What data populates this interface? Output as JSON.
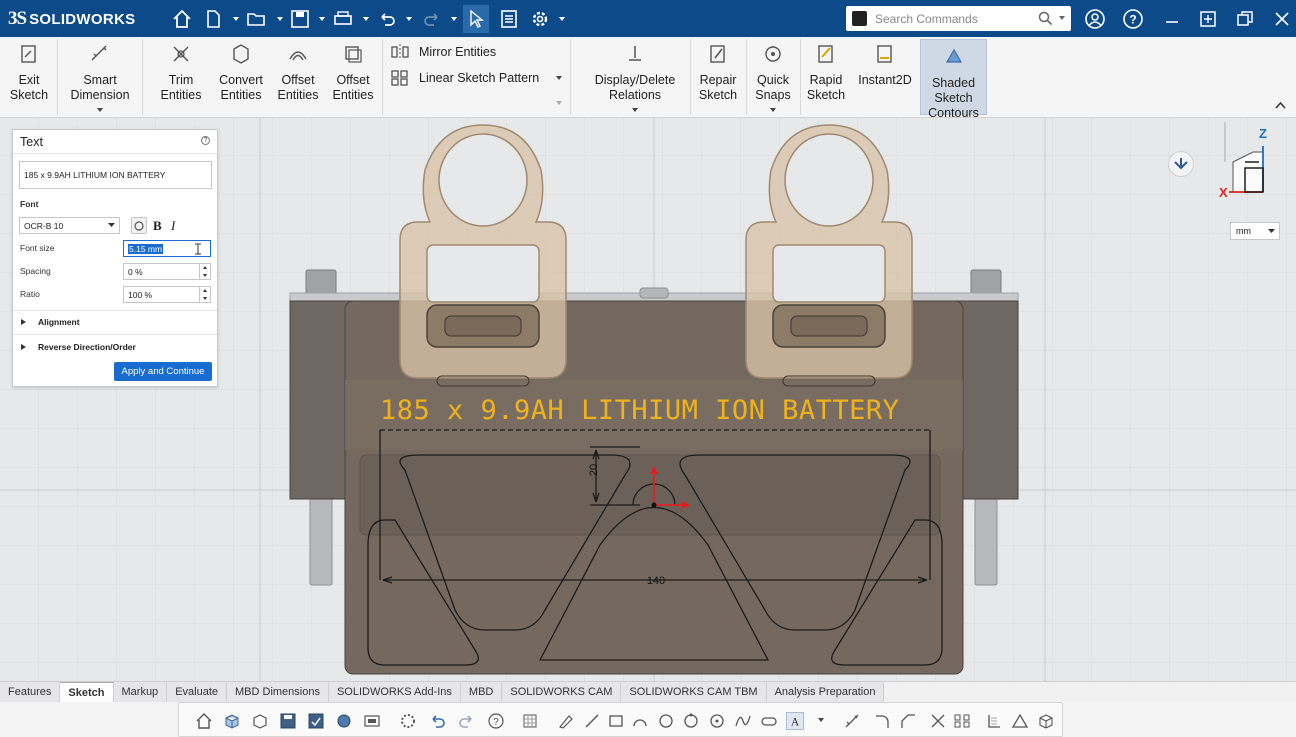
{
  "app": {
    "logo_mark": "3S",
    "logo_name": "SOLIDWORKS",
    "brand_color": "#0c4a8a",
    "search_placeholder": "Search Commands"
  },
  "titlebar_icons": [
    "home-icon",
    "new-document-icon",
    "open-folder-icon",
    "save-icon",
    "print-icon",
    "undo-icon",
    "redo-icon",
    "select-arrow-icon",
    "file-properties-icon",
    "options-gear-icon",
    "user-icon",
    "help-icon",
    "minimize-icon",
    "restore-icon",
    "maximize-icon",
    "close-icon"
  ],
  "ribbon": {
    "exit_sketch": "Exit\nSketch",
    "smart_dimension": "Smart\nDimension",
    "trim_entities": "Trim\nEntities",
    "convert_entities": "Convert\nEntities",
    "offset_entities": "Offset\nEntities",
    "offset_entities_2": "Offset\nEntities",
    "mirror_entities": "Mirror Entities",
    "linear_sketch_pattern": "Linear Sketch Pattern",
    "display_delete_relations": "Display/Delete\nRelations",
    "repair_sketch": "Repair\nSketch",
    "quick_snaps": "Quick\nSnaps",
    "rapid_sketch": "Rapid\nSketch",
    "instant2d": "Instant2D",
    "shaded_sketch_contours": "Shaded\nSketch\nContours"
  },
  "property_manager": {
    "title": "Text",
    "help": "?",
    "text_value": "185 x 9.9AH LITHIUM ION BATTERY",
    "font_heading": "Font",
    "font_value": "OCR-B 10",
    "bold": "B",
    "italic": "I",
    "font_size_label": "Font size",
    "font_size_value": "5.15 mm",
    "spacing_label": "Spacing",
    "spacing_value": "0 %",
    "ratio_label": "Ratio",
    "ratio_value": "100 %",
    "alignment": "Alignment",
    "reverse_direction": "Reverse Direction/Order",
    "apply_button": "Apply and Continue"
  },
  "viewport": {
    "engraving_text": "185 x 9.9AH LITHIUM ION BATTERY",
    "engraving_color": "#f0b21b",
    "dim_vertical": "20",
    "dim_horizontal": "140",
    "axis_z": "Z",
    "axis_x": "X",
    "units_value": "mm"
  },
  "tabs": [
    {
      "label": "Features",
      "active": false
    },
    {
      "label": "Sketch",
      "active": true
    },
    {
      "label": "Markup",
      "active": false
    },
    {
      "label": "Evaluate",
      "active": false
    },
    {
      "label": "MBD Dimensions",
      "active": false
    },
    {
      "label": "SOLIDWORKS Add-Ins",
      "active": false
    },
    {
      "label": "MBD",
      "active": false
    },
    {
      "label": "SOLIDWORKS CAM",
      "active": false
    },
    {
      "label": "SOLIDWORKS CAM TBM",
      "active": false
    },
    {
      "label": "Analysis Preparation",
      "active": false
    }
  ],
  "heads_up_icons": [
    "home-view-icon",
    "view-orientation-icon",
    "display-style-icon",
    "save-icon",
    "save-all-icon",
    "rebuild-icon",
    "options-icon",
    "settings-icon",
    "undo-icon",
    "redo-icon",
    "help-icon",
    "grid-icon",
    "sketch-icon",
    "line-icon",
    "rectangle-icon",
    "arc-icon",
    "circle-icon",
    "circle-perimeter-icon",
    "point-circle-icon",
    "spline-icon",
    "slot-icon",
    "text-icon",
    "more-icon",
    "dimension-icon",
    "fillet-icon",
    "chamfer-icon",
    "trim-icon",
    "mirror-icon",
    "plane-icon",
    "triangle-icon",
    "3d-view-icon"
  ]
}
